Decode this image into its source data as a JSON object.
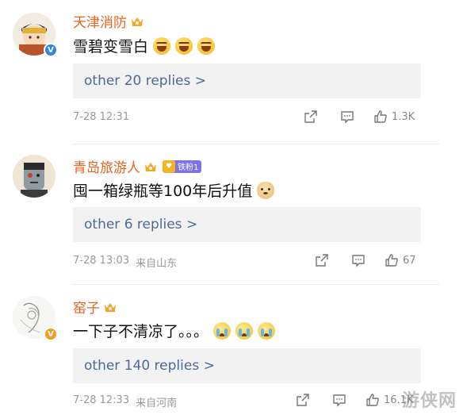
{
  "comments": [
    {
      "username": "天津消防",
      "text": "雪碧变雪白",
      "emojis": [
        "laugh",
        "laugh",
        "laugh"
      ],
      "replies": "other 20 replies >",
      "time": "7-28 12:31",
      "location": "",
      "likes": "1.3K",
      "badge": "blue-v"
    },
    {
      "username": "青岛旅游人",
      "fan_badge": "铁粉1",
      "text": "囤一箱绿瓶等100年后升值",
      "emojis": [
        "doge"
      ],
      "replies": "other 6 replies >",
      "time": "7-28 13:03",
      "location": "来自山东",
      "likes": "67",
      "badge": "none"
    },
    {
      "username": "窑子",
      "text": "一下子不清凉了。。。",
      "emojis": [
        "cry",
        "cry",
        "cry"
      ],
      "replies": "other 140 replies >",
      "time": "7-28 12:33",
      "location": "来自河南",
      "likes": "16.1K",
      "badge": "orange-v"
    }
  ],
  "watermark": "游侠网",
  "colors": {
    "username": "#e8631f",
    "replies_link": "#4b6a9a",
    "replies_bg": "#f2f2f2",
    "meta": "#999999",
    "fan_badge": "#7d72e8"
  },
  "icons": [
    "crown-icon",
    "share-icon",
    "comment-icon",
    "like-icon",
    "verified-icon"
  ]
}
